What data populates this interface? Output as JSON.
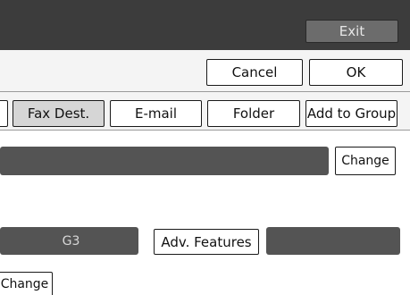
{
  "header": {
    "exit_label": "Exit"
  },
  "actions": {
    "cancel_label": "Cancel",
    "ok_label": "OK"
  },
  "tabs": [
    {
      "label": "Fax Dest.",
      "selected": true
    },
    {
      "label": "E-mail",
      "selected": false
    },
    {
      "label": "Folder",
      "selected": false
    },
    {
      "label": "Add to Group",
      "selected": false
    }
  ],
  "name_row": {
    "change_label": "Change"
  },
  "fax_row": {
    "mode_value": "G3",
    "adv_features_label": "Adv. Features"
  },
  "bottom_row": {
    "change_label": "Change"
  }
}
